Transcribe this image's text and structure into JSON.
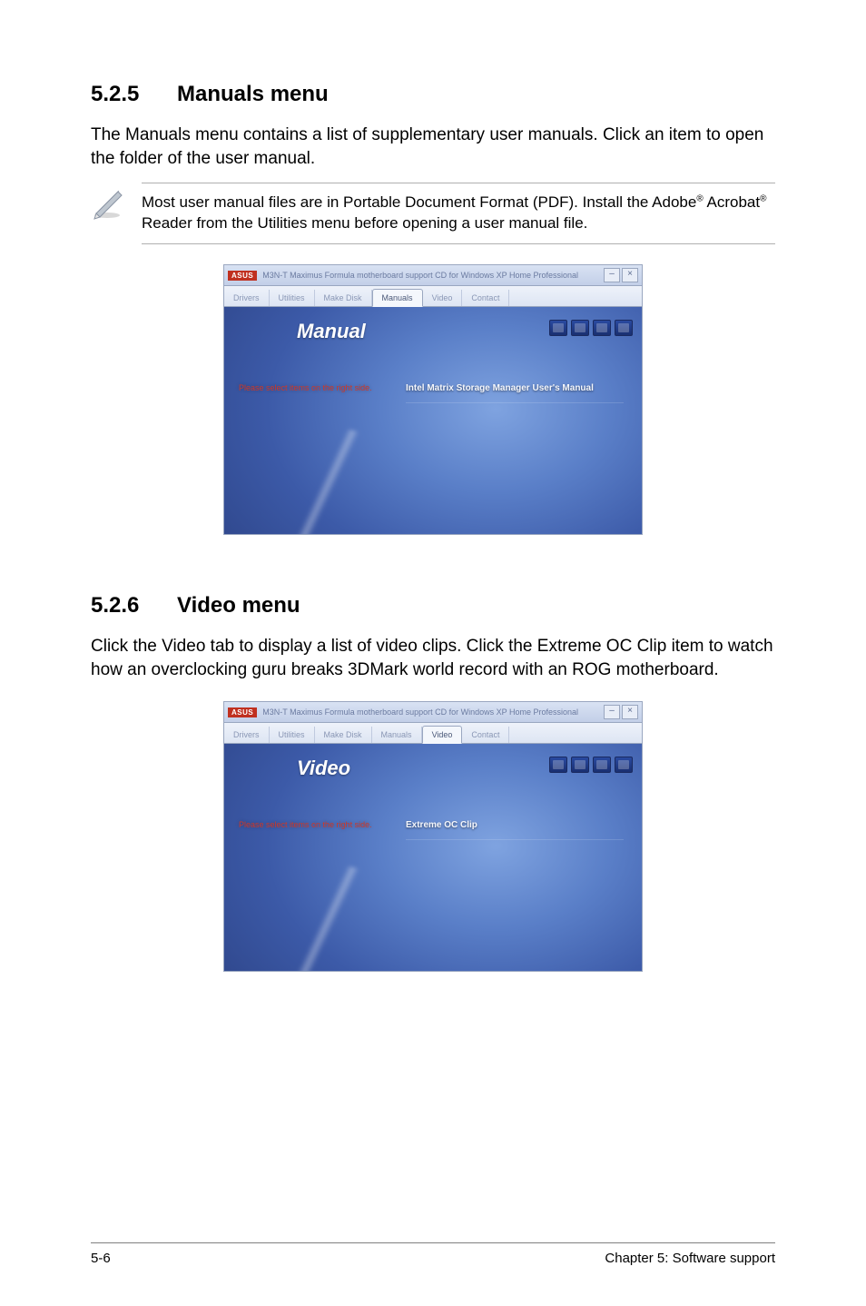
{
  "section1": {
    "number": "5.2.5",
    "title": "Manuals menu",
    "body": "The Manuals menu contains a list of supplementary user manuals. Click an item to open the folder of the user manual.",
    "note_pre": "Most user manual files are in Portable Document Format (PDF). Install the Adobe",
    "note_sup1": "®",
    "note_mid": " Acrobat",
    "note_sup2": "®",
    "note_post": " Reader from the Utilities menu before opening a user manual file."
  },
  "screenshot1": {
    "logo": "ASUS",
    "title": "M3N-T Maximus Formula motherboard support CD for Windows XP Home Professional",
    "min": "–",
    "close": "×",
    "tabs": {
      "drivers": "Drivers",
      "utilities": "Utilities",
      "makedisk": "Make Disk",
      "manuals": "Manuals",
      "video": "Video",
      "contact": "Contact"
    },
    "panel_title": "Manual",
    "prompt": "Please select items on the right side.",
    "link": "Intel Matrix Storage Manager User's Manual"
  },
  "section2": {
    "number": "5.2.6",
    "title": "Video menu",
    "body": "Click the Video tab to display a list of video clips. Click the Extreme OC Clip item to watch how an overclocking guru breaks 3DMark world record with an ROG motherboard."
  },
  "screenshot2": {
    "logo": "ASUS",
    "title": "M3N-T Maximus Formula motherboard support CD for Windows XP Home Professional",
    "min": "–",
    "close": "×",
    "tabs": {
      "drivers": "Drivers",
      "utilities": "Utilities",
      "makedisk": "Make Disk",
      "manuals": "Manuals",
      "video": "Video",
      "contact": "Contact"
    },
    "panel_title": "Video",
    "prompt": "Please select items on the right side.",
    "link": "Extreme OC Clip"
  },
  "footer": {
    "left": "5-6",
    "right": "Chapter 5: Software support"
  }
}
